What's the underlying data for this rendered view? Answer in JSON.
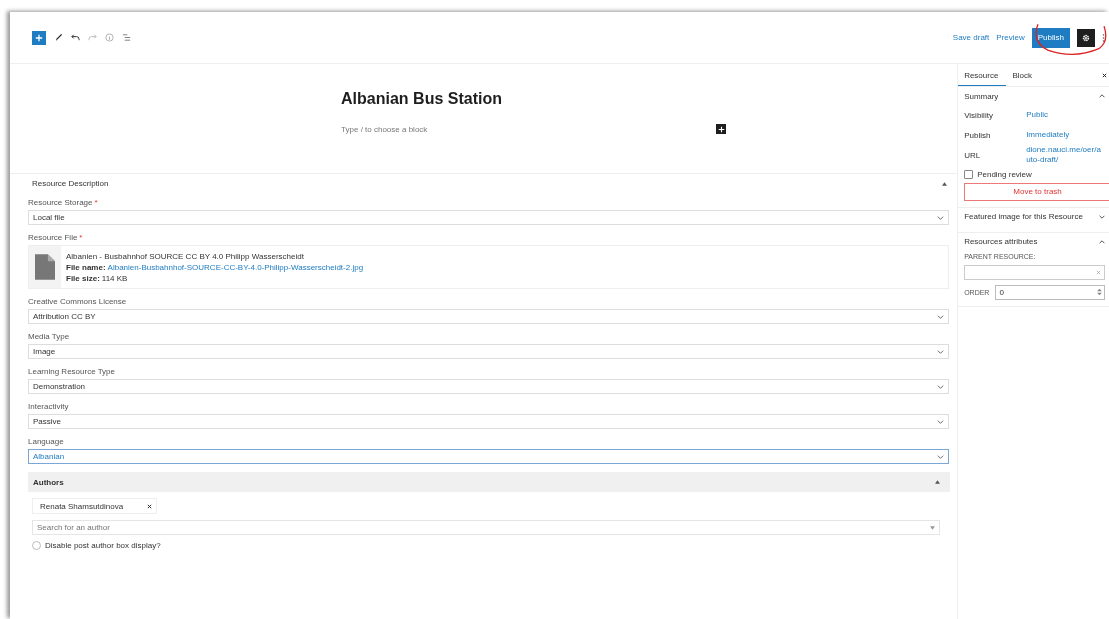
{
  "toolbar": {
    "save_draft": "Save draft",
    "preview": "Preview",
    "publish": "Publish"
  },
  "editor": {
    "title": "Albanian Bus Station",
    "block_placeholder": "Type / to choose a block"
  },
  "resource_description": {
    "title": "Resource Description",
    "expanded": true,
    "fields": [
      {
        "kind": "select",
        "label": "Resource Storage",
        "required_mark": "*",
        "value": "Local file",
        "focused": false
      },
      {
        "kind": "file",
        "label": "Resource File",
        "required_mark": "*",
        "file_title": "Albanien - Busbahnhof SOURCE CC BY 4.0 Philipp Wasserscheidt",
        "file_name_label": "File name:",
        "file_name": "Albanien-Busbahnhof-SOURCE-CC-BY-4.0-Philipp-Wasserscheidt-2.jpg",
        "file_size_label": "File size:",
        "file_size": "114 KB"
      },
      {
        "kind": "select",
        "label": "Creative Commons License",
        "value": "Attribution CC BY",
        "focused": false
      },
      {
        "kind": "select",
        "label": "Media Type",
        "value": "Image",
        "focused": false
      },
      {
        "kind": "select",
        "label": "Learning Resource Type",
        "value": "Demonstration",
        "focused": false
      },
      {
        "kind": "select",
        "label": "Interactivity",
        "value": "Passive",
        "focused": false
      },
      {
        "kind": "select",
        "label": "Language",
        "value": "Albanian",
        "focused": true
      }
    ]
  },
  "authors": {
    "title": "Authors",
    "expanded": true,
    "chips": [
      {
        "label": "Renata Shamsutdinova"
      }
    ],
    "search": {
      "placeholder": "Search for an author"
    },
    "disable_box": {
      "label": "Disable post author box display?",
      "checked": false
    }
  },
  "sidebar": {
    "tabs": [
      {
        "label": "Resource",
        "selected": true
      },
      {
        "label": "Block",
        "selected": false
      }
    ],
    "summary": {
      "title": "Summary",
      "expanded": true,
      "rows": [
        {
          "label": "Visibility",
          "value": "Public"
        },
        {
          "label": "Publish",
          "value": "Immediately"
        },
        {
          "label": "URL",
          "value": "dione.nauci.me/oer/auto-draft/"
        }
      ]
    },
    "pending_review": {
      "label": "Pending review",
      "checked": false
    },
    "trash": "Move to trash",
    "featured_image": {
      "title": "Featured image for this Resource",
      "expanded": false
    },
    "attributes": {
      "title": "Resources attributes",
      "expanded": true,
      "parent_label": "PARENT RESOURCE:",
      "order_label": "ORDER",
      "order_value": "0"
    }
  }
}
